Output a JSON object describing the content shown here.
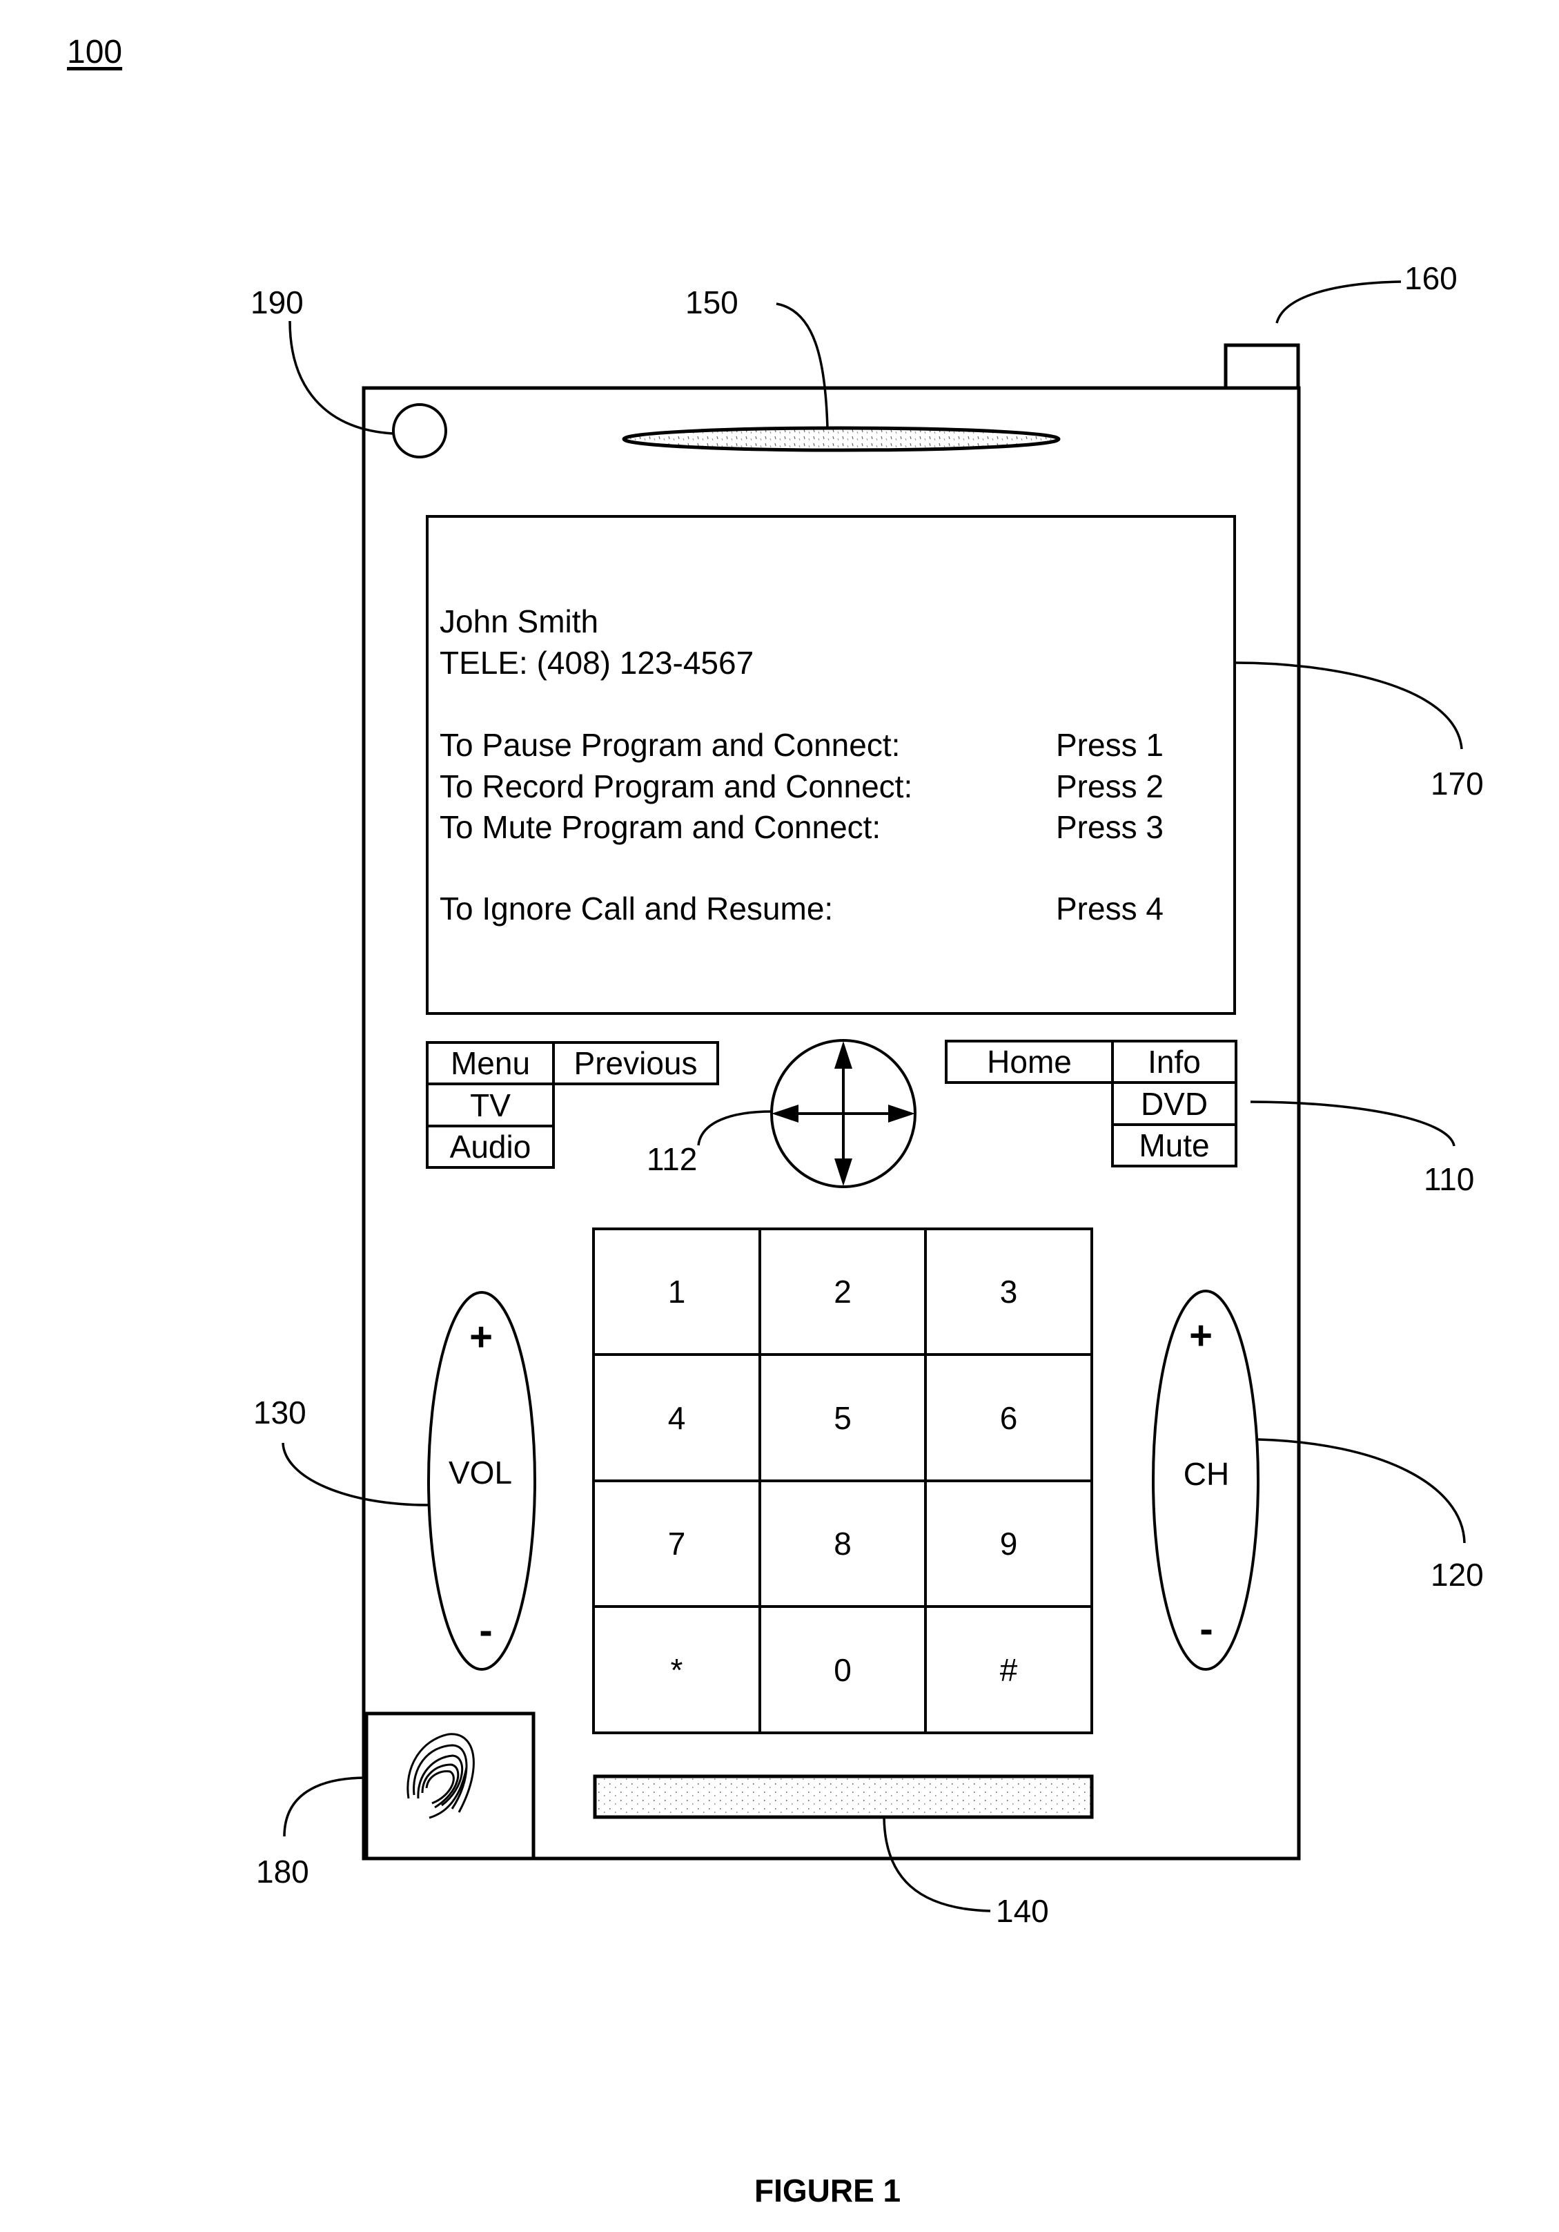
{
  "figure": {
    "number": "100",
    "caption": "FIGURE 1"
  },
  "reference_numerals": {
    "sensor": "190",
    "speaker": "150",
    "antenna": "160",
    "display": "170",
    "function_buttons": "110",
    "navigation_pad": "112",
    "volume_control": "130",
    "channel_control": "120",
    "fingerprint_reader": "180",
    "strip": "140"
  },
  "display": {
    "caller_name": "John Smith",
    "caller_phone": "TELE: (408) 123-4567",
    "options": [
      {
        "text": "To Pause Program and Connect:",
        "action": "Press 1"
      },
      {
        "text": "To Record Program and Connect:",
        "action": "Press 2"
      },
      {
        "text": "To Mute Program and Connect:",
        "action": "Press 3"
      },
      {
        "text": "To Ignore Call and Resume:",
        "action": "Press 4"
      }
    ]
  },
  "left_buttons": {
    "menu": "Menu",
    "previous": "Previous",
    "tv": "TV",
    "audio": "Audio"
  },
  "right_buttons": {
    "home": "Home",
    "info": "Info",
    "dvd": "DVD",
    "mute": "Mute"
  },
  "keypad": [
    "1",
    "2",
    "3",
    "4",
    "5",
    "6",
    "7",
    "8",
    "9",
    "*",
    "0",
    "#"
  ],
  "volume": {
    "label": "VOL",
    "plus": "+",
    "minus": "-"
  },
  "channel": {
    "label": "CH",
    "plus": "+",
    "minus": "-"
  },
  "icons": {
    "navigation_pad": "four-way-arrow-icon",
    "fingerprint": "fingerprint-icon",
    "sensor": "circle-sensor-icon",
    "speaker": "speaker-grille-icon"
  }
}
